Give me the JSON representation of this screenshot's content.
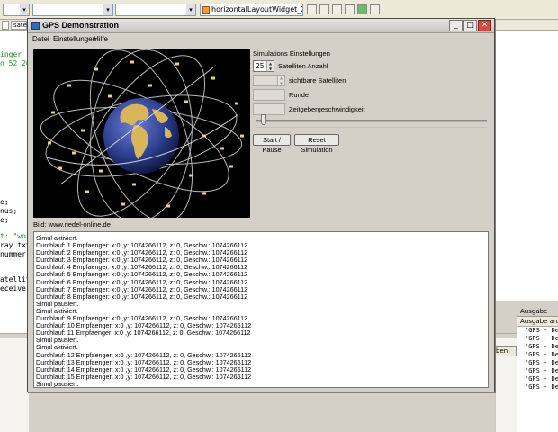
{
  "ide": {
    "toolbar": {
      "widget_combo": "horizontalLayoutWidget_2"
    },
    "tabs": [
      "satellit"
    ],
    "code_lines": [
      {
        "text": "inger",
        "color": "#2a8a2a"
      },
      {
        "text": "n 52 20",
        "color": "#2a8a2a"
      },
      {
        "text": "e;",
        "color": "#000000"
      },
      {
        "text": "nus;",
        "color": "#000000"
      },
      {
        "text": "e;",
        "color": "#000000"
      },
      {
        "text": "t: \"wor",
        "color": "#2a8a2a"
      },
      {
        "text": "ray txt +",
        "color": "#000000"
      },
      {
        "text": "nummer;",
        "color": "#000000"
      },
      {
        "text": "atellit",
        "color": "#000000"
      },
      {
        "text": "eceiver",
        "color": "#000000"
      }
    ],
    "bottom_button": "ben",
    "ausgabe": {
      "title": "Ausgabe",
      "tab": "Ausgabe anzeigen",
      "lines": [
        "\"GPS - Dem",
        "\"GPS - Dem",
        "\"GPS - Dem",
        "\"GPS - Dem",
        "\"GPS - Dem",
        "\"GPS - Dem",
        "\"GPS - Dem",
        "\"GPS - Dem"
      ]
    }
  },
  "window": {
    "title": "GPS Demonstration",
    "controls": {
      "minimize": "_",
      "maximize": "□",
      "close": "✕"
    },
    "menu": [
      "Datei",
      "Einstellungen",
      "Hilfe"
    ],
    "image_credit": "Bild: www.riedel-online.de",
    "settings": {
      "title": "Simulations Einstellungen",
      "satellite_count_value": "25",
      "satellite_count_label": "Satelliten Anzahl",
      "visible_sat_label": "sichtbare Satelliten",
      "round_label": "Runde",
      "timer_label": "Zeitgebergeschwindigkeit",
      "timer_speed_fraction": 0.02
    },
    "buttons": {
      "start_pause": "Start / Pause",
      "reset": "Reset Simulation"
    },
    "log": [
      "Simul aktiviert.",
      "Durchlauf: 1 Empfaenger: x:0 ,y: 1074266112, z: 0, Geschw.: 1074266112",
      "Durchlauf: 2 Empfaenger: x:0 ,y: 1074266112, z: 0, Geschw.: 1074266112",
      "Durchlauf: 3 Empfaenger: x:0 ,y: 1074266112, z: 0, Geschw.: 1074266112",
      "Durchlauf: 4 Empfaenger: x:0 ,y: 1074266112, z: 0, Geschw.: 1074266112",
      "Durchlauf: 5 Empfaenger: x:0 ,y: 1074266112, z: 0, Geschw.: 1074266112",
      "Durchlauf: 6 Empfaenger: x:0 ,y: 1074266112, z: 0, Geschw.: 1074266112",
      "Durchlauf: 7 Empfaenger: x:0 ,y: 1074266112, z: 0, Geschw.: 1074266112",
      "Durchlauf: 8 Empfaenger: x:0 ,y: 1074266112, z: 0, Geschw.: 1074266112",
      "Simul pausiert.",
      "Simul aktiviert.",
      "Durchlauf: 9 Empfaenger: x:0 ,y: 1074266112, z: 0, Geschw.: 1074266112",
      "Durchlauf: 10 Empfaenger: x:0 ,y: 1074266112, z: 0, Geschw.: 1074266112",
      "Durchlauf: 11 Empfaenger: x:0 ,y: 1074266112, z: 0, Geschw.: 1074266112",
      "Simul pausiert.",
      "Simul aktiviert.",
      "Durchlauf: 12 Empfaenger: x:0 ,y: 1074266112, z: 0, Geschw.: 1074266112",
      "Durchlauf: 13 Empfaenger: x:0 ,y: 1074266112, z: 0, Geschw.: 1074266112",
      "Durchlauf: 14 Empfaenger: x:0 ,y: 1074266112, z: 0, Geschw.: 1074266112",
      "Durchlauf: 15 Empfaenger: x:0 ,y: 1074266112, z: 0, Geschw.: 1074266112",
      "Simul pausiert."
    ]
  },
  "colors": {
    "earth_ocean": "#2d3f8f",
    "earth_land": "#d9b65a",
    "orbit": "#d8d8d8"
  }
}
